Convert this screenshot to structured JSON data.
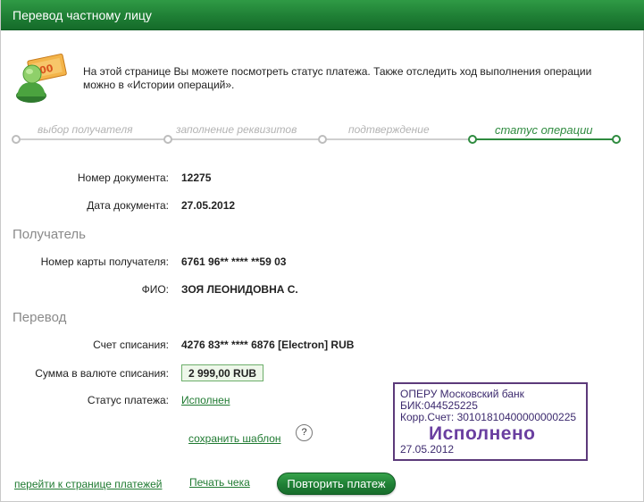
{
  "window": {
    "title": "Перевод частному лицу"
  },
  "intro": {
    "line1": "На этой странице Вы можете посмотреть статус платежа. Также отследить ход выполнения операции",
    "line2": "можно в «Истории операций»."
  },
  "steps": [
    {
      "label": "выбор получателя",
      "active": false
    },
    {
      "label": "заполнение реквизитов",
      "active": false
    },
    {
      "label": "подтверждение",
      "active": false
    },
    {
      "label": "статус операции",
      "active": true
    }
  ],
  "document": {
    "number_label": "Номер документа:",
    "number_value": "12275",
    "date_label": "Дата документа:",
    "date_value": "27.05.2012"
  },
  "recipient": {
    "section_title": "Получатель",
    "card_label": "Номер карты получателя:",
    "card_value": "6761 96** **** **59 03",
    "name_label": "ФИО:",
    "name_value": "ЗОЯ ЛЕОНИДОВНА С."
  },
  "transfer": {
    "section_title": "Перевод",
    "account_label": "Счет списания:",
    "account_value": "4276 83** **** 6876  [Electron]  RUB",
    "amount_label": "Сумма в валюте списания:",
    "amount_value": "2 999,00  RUB",
    "status_label": "Статус платежа:",
    "status_value": "Исполнен"
  },
  "actions": {
    "save_template": "сохранить шаблон",
    "help": "?",
    "back_to_payments": "перейти к странице платежей",
    "print_receipt": "Печать чека",
    "repeat_payment": "Повторить платеж"
  },
  "stamp": {
    "line1": "ОПЕРУ Московский банк",
    "line2": "БИК:044525225",
    "line3": "Корр.Счет: 30101810400000000225",
    "status": "Исполнено",
    "date": "27.05.2012"
  },
  "colors": {
    "brand_green": "#1f7f35",
    "link_green": "#1f7a31",
    "stamp_purple": "#5c3a7a"
  }
}
